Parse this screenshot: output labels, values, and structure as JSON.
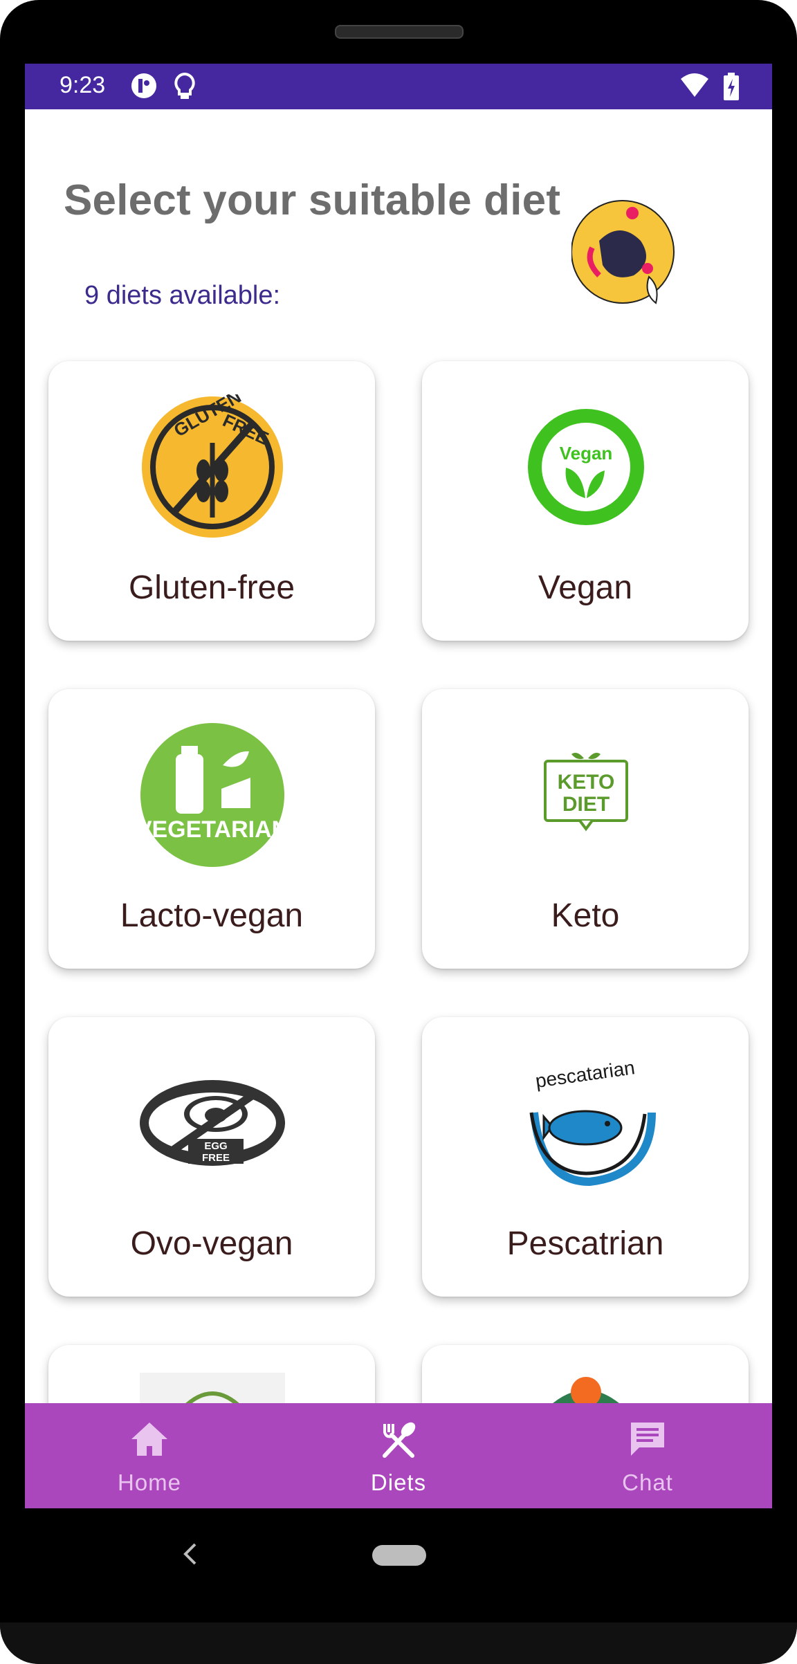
{
  "status_bar": {
    "time": "9:23",
    "color": "#4527a0",
    "icons": [
      "key-icon",
      "lightbulb-icon",
      "wifi-icon",
      "battery-charging-icon"
    ]
  },
  "header": {
    "title": "Select your suitable diet",
    "subtitle": "9 diets available:",
    "logo": "app-logo-icon"
  },
  "diets": [
    {
      "label": "Gluten-free",
      "icon": "gluten-free-icon"
    },
    {
      "label": "Vegan",
      "icon": "vegan-icon"
    },
    {
      "label": "Lacto-vegan",
      "icon": "vegetarian-milk-icon"
    },
    {
      "label": "Keto",
      "icon": "keto-diet-icon"
    },
    {
      "label": "Ovo-vegan",
      "icon": "egg-free-icon"
    },
    {
      "label": "Pescatrian",
      "icon": "pescatarian-fish-icon"
    }
  ],
  "bottom_nav": {
    "color": "#ab47bc",
    "items": [
      {
        "label": "Home",
        "icon": "home-icon",
        "active": false
      },
      {
        "label": "Diets",
        "icon": "utensils-icon",
        "active": true
      },
      {
        "label": "Chat",
        "icon": "chat-icon",
        "active": false
      }
    ]
  }
}
